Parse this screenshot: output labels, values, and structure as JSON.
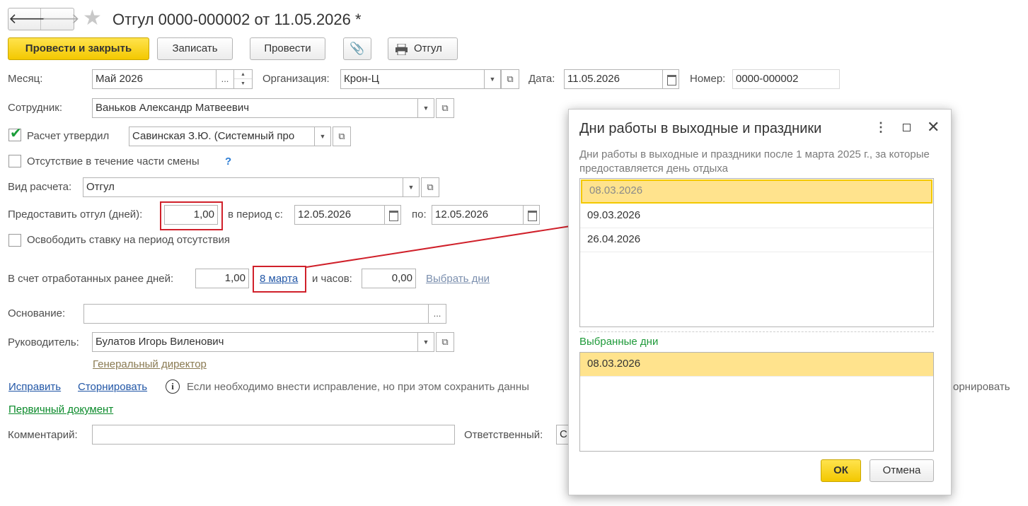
{
  "window": {
    "title": "Отгул 0000-000002 от 11.05.2026 *"
  },
  "toolbar": {
    "post_close": "Провести и закрыть",
    "save": "Записать",
    "post": "Провести",
    "print": "Отгул"
  },
  "form": {
    "month_label": "Месяц:",
    "month_value": "Май 2026",
    "month_pick": "...",
    "org_label": "Организация:",
    "org_value": "Крон-Ц",
    "date_label": "Дата:",
    "date_value": "11.05.2026",
    "number_label": "Номер:",
    "number_value": "0000-000002",
    "employee_label": "Сотрудник:",
    "employee_value": "Ваньков Александр Матвеевич",
    "approved_label": "Расчет утвердил",
    "approved_value": "Савинская З.Ю. (Системный про",
    "partial_label": "Отсутствие в течение части смены",
    "help": "?",
    "calc_type_label": "Вид расчета:",
    "calc_type_value": "Отгул",
    "days_label": "Предоставить отгул (дней):",
    "days_value": "1,00",
    "period_from_label": "в период с:",
    "period_from": "12.05.2026",
    "period_to_label": "по:",
    "period_to": "12.05.2026",
    "free_rate_label": "Освободить ставку на период отсутствия",
    "worked_days_label": "В счет отработанных ранее дней:",
    "worked_days_value": "1,00",
    "worked_date_link": "8 марта",
    "hours_label": "и часов:",
    "hours_value": "0,00",
    "select_days_link": "Выбрать дни",
    "basis_label": "Основание:",
    "basis_value": "",
    "basis_pick": "...",
    "manager_label": "Руководитель:",
    "manager_value": "Булатов Игорь Виленович",
    "manager_position": "Генеральный директор",
    "fix_link": "Исправить",
    "reverse_link": "Сторнировать",
    "info_text": "Если необходимо внести исправление, но при этом сохранить данны",
    "info_tail": "орнировать",
    "primary_doc_link": "Первичный документ",
    "comment_label": "Комментарий:",
    "comment_value": "",
    "responsible_label": "Ответственный:",
    "responsible_value": "С"
  },
  "dialog": {
    "title": "Дни работы в выходные и праздники",
    "description": "Дни работы в выходные и праздники после 1 марта 2025 г., за которые предоставляется день отдыха",
    "available_days": [
      "08.03.2026",
      "09.03.2026",
      "26.04.2026"
    ],
    "selected_title": "Выбранные дни",
    "selected_days": [
      "08.03.2026"
    ],
    "ok": "ОК",
    "cancel": "Отмена"
  },
  "colors": {
    "accent": "#f3c800",
    "highlight": "#ffe38d",
    "annotation": "#d0202a",
    "link": "#2156a6"
  }
}
